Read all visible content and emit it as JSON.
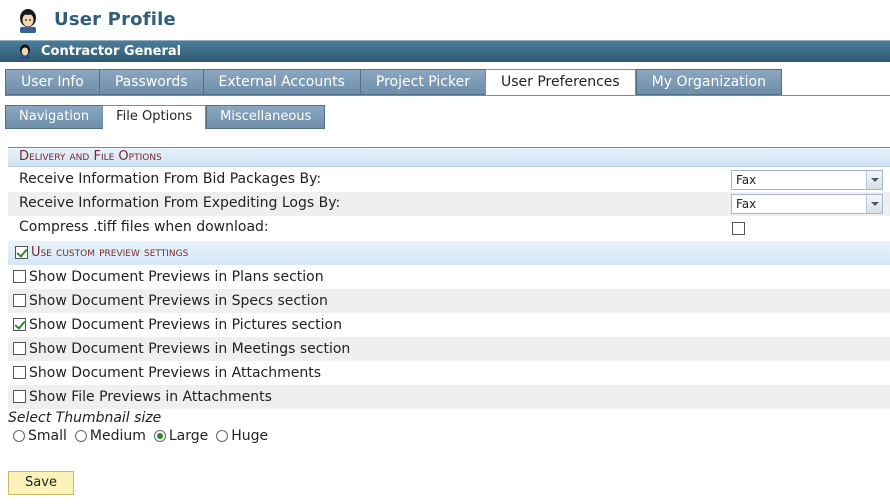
{
  "header": {
    "title": "User Profile"
  },
  "org": {
    "name": "Contractor General"
  },
  "main_tabs": [
    {
      "label": "User Info"
    },
    {
      "label": "Passwords"
    },
    {
      "label": "External Accounts"
    },
    {
      "label": "Project Picker"
    },
    {
      "label": "User Preferences",
      "active": true
    },
    {
      "label": "My Organization"
    }
  ],
  "sub_tabs": [
    {
      "label": "Navigation"
    },
    {
      "label": "File Options",
      "active": true
    },
    {
      "label": "Miscellaneous"
    }
  ],
  "section": {
    "title": "Delivery and File Options",
    "rows": [
      {
        "label": "Receive Information From Bid Packages By:",
        "value": "Fax"
      },
      {
        "label": "Receive Information From Expediting Logs By:",
        "value": "Fax"
      },
      {
        "label": "Compress .tiff files when download:",
        "checked": false
      }
    ]
  },
  "custom_preview": {
    "label": "Use custom preview settings",
    "checked": true
  },
  "previews": [
    {
      "label": "Show Document Previews in Plans section",
      "checked": false
    },
    {
      "label": "Show Document Previews in Specs section",
      "checked": false
    },
    {
      "label": "Show Document Previews in Pictures section",
      "checked": true
    },
    {
      "label": "Show Document Previews in Meetings section",
      "checked": false
    },
    {
      "label": "Show Document Previews in Attachments",
      "checked": false
    },
    {
      "label": "Show File Previews in Attachments",
      "checked": false
    }
  ],
  "thumbnail": {
    "label": "Select Thumbnail size",
    "options": [
      "Small",
      "Medium",
      "Large",
      "Huge"
    ],
    "selected": "Large"
  },
  "save_label": "Save",
  "colors": {
    "accent": "#2f5d7a",
    "tab": "#7f9cb7",
    "save": "#fbf3b8"
  }
}
